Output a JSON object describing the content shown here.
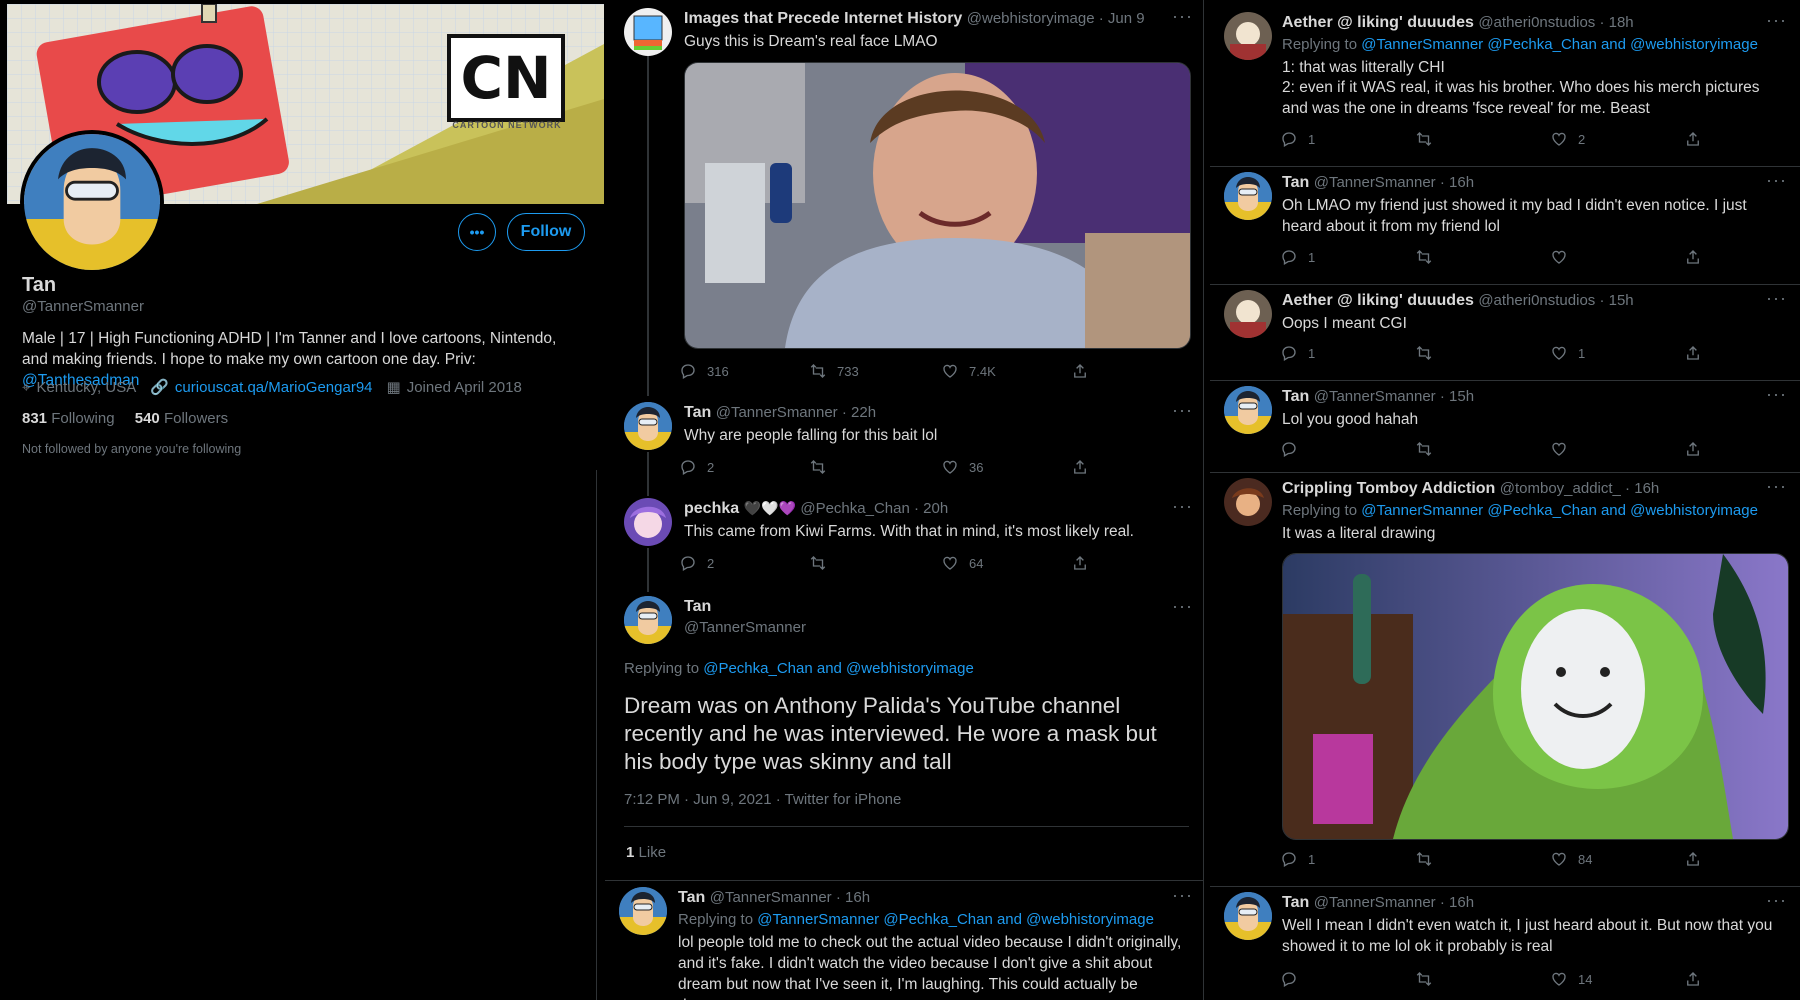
{
  "colors": {
    "accent": "#1d9bf0",
    "bg": "#000000",
    "text": "#d9d9d9",
    "muted": "#6e767d"
  },
  "profile": {
    "banner_logo": "CN",
    "banner_logo_sub": "CARTOON NETWORK",
    "name": "Tan",
    "handle": "@TannerSmanner",
    "bio_prefix": "Male | 17 | High Functioning ADHD | I'm Tanner and I love cartoons, Nintendo, and making friends. I hope to make my own cartoon one day. Priv: ",
    "bio_link": "@Tanthesadman",
    "location": "Kentucky, USA",
    "website": "curiouscat.qa/MarioGengar94",
    "joined": "Joined April 2018",
    "following_count": "831",
    "following_label": "Following",
    "followers_count": "540",
    "followers_label": "Followers",
    "followed_by": "Not followed by anyone you're following",
    "more_button": "•••",
    "follow_button": "Follow"
  },
  "middle": {
    "tweet1": {
      "name": "Images that Precede Internet History",
      "meta": "@webhistoryimage · Jun 9",
      "text": "Guys this is Dream's real face LMAO",
      "replies": "316",
      "retweets": "733",
      "likes": "7.4K"
    },
    "tweet2": {
      "name": "Tan",
      "meta": "@TannerSmanner · 22h",
      "text": "Why are people falling for this bait lol",
      "replies": "2",
      "retweets": "",
      "likes": "36"
    },
    "tweet3": {
      "name": "pechka",
      "emoji": "🖤🤍💜",
      "meta": "@Pechka_Chan · 20h",
      "text": "This came from Kiwi Farms. With that in mind, it's most likely real.",
      "replies": "2",
      "retweets": "",
      "likes": "64"
    },
    "main": {
      "name": "Tan",
      "handle": "@TannerSmanner",
      "replying_label": "Replying to ",
      "replying_links": "@Pechka_Chan and @webhistoryimage",
      "text": "Dream was on Anthony Palida's YouTube channel recently and he was interviewed. He wore a mask but his body type was skinny and tall",
      "timestamp": "7:12 PM · Jun 9, 2021 · Twitter for iPhone",
      "like_count": "1",
      "like_label": "Like"
    },
    "tweet4": {
      "name": "Tan",
      "meta": "@TannerSmanner · 16h",
      "replying_label": "Replying to ",
      "replying_links": "@TannerSmanner @Pechka_Chan and @webhistoryimage",
      "text": "lol people told me to check out the actual video because I didn't originally, and it's fake. I didn't watch the video because I don't give a shit about dream but now that I've seen it, I'm laughing. This could actually be dream"
    }
  },
  "right": {
    "r1": {
      "name": "Aether @ liking' duuudes",
      "meta": "@atheri0nstudios · 18h",
      "replying_label": "Replying to ",
      "replying_links": "@TannerSmanner @Pechka_Chan and @webhistoryimage",
      "line1": "1: that was litterally CHI",
      "line2": "2: even if it WAS real, it was his brother. Who does his merch pictures and was the one in dreams 'fsce reveal' for me. Beast",
      "replies": "1",
      "retweets": "",
      "likes": "2"
    },
    "r2": {
      "name": "Tan",
      "meta": "@TannerSmanner · 16h",
      "text": "Oh LMAO my friend just showed it my bad I didn't even notice. I just heard about it from my friend lol",
      "replies": "1",
      "retweets": "",
      "likes": ""
    },
    "r3": {
      "name": "Aether @ liking' duuudes",
      "meta": "@atheri0nstudios · 15h",
      "text": "Oops I meant CGI",
      "replies": "1",
      "retweets": "",
      "likes": "1"
    },
    "r4": {
      "name": "Tan",
      "meta": "@TannerSmanner · 15h",
      "text": "Lol you good hahah",
      "replies": "",
      "retweets": "",
      "likes": ""
    },
    "r5": {
      "name": "Crippling Tomboy Addiction",
      "meta": "@tomboy_addict_ · 16h",
      "replying_label": "Replying to ",
      "replying_links": "@TannerSmanner @Pechka_Chan and @webhistoryimage",
      "text": "It was a literal drawing",
      "replies": "1",
      "retweets": "",
      "likes": "84"
    },
    "r6": {
      "name": "Tan",
      "meta": "@TannerSmanner · 16h",
      "text": "Well I mean I didn't even watch it, I just heard about it. But now that you showed it to me lol ok it probably is real",
      "replies": "",
      "retweets": "",
      "likes": "14"
    }
  },
  "icons": [
    "location-icon",
    "link-icon",
    "calendar-icon",
    "reply-icon",
    "retweet-icon",
    "like-icon",
    "share-icon",
    "more-icon"
  ]
}
